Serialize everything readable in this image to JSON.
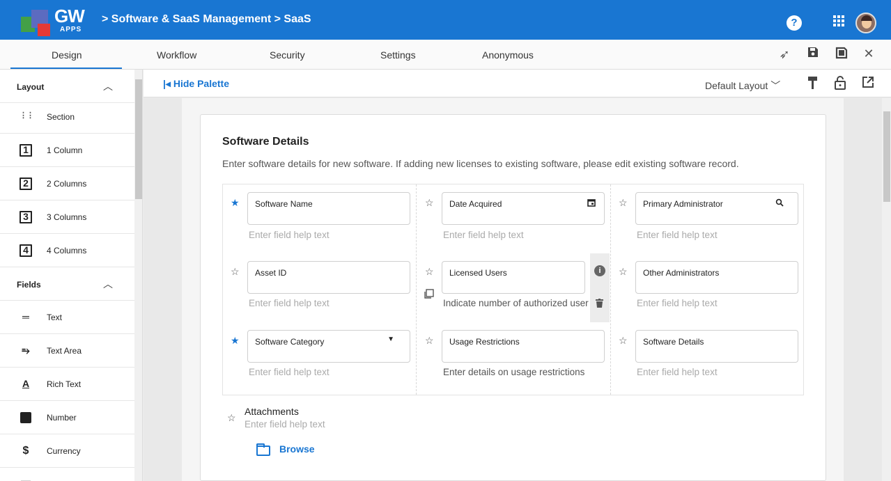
{
  "header": {
    "logo_text": "GW",
    "logo_sub": "APPS",
    "breadcrumb": "> Software & SaaS Management > SaaS",
    "help_label": "?"
  },
  "tabs": [
    {
      "label": "Design"
    },
    {
      "label": "Workflow"
    },
    {
      "label": "Security"
    },
    {
      "label": "Settings"
    },
    {
      "label": "Anonymous"
    }
  ],
  "sidebar": {
    "layout_title": "Layout",
    "fields_title": "Fields",
    "layout_items": [
      {
        "label": "Section",
        "icon": "section-icon",
        "glyph": "⋮⋮"
      },
      {
        "label": "1 Column",
        "icon": "one-column-icon",
        "glyph": "1"
      },
      {
        "label": "2 Columns",
        "icon": "two-columns-icon",
        "glyph": "2"
      },
      {
        "label": "3 Columns",
        "icon": "three-columns-icon",
        "glyph": "3"
      },
      {
        "label": "4 Columns",
        "icon": "four-columns-icon",
        "glyph": "4"
      }
    ],
    "field_items": [
      {
        "label": "Text",
        "icon": "text-icon",
        "glyph": "═"
      },
      {
        "label": "Text Area",
        "icon": "text-area-icon",
        "glyph": "⥱"
      },
      {
        "label": "Rich Text",
        "icon": "rich-text-icon",
        "glyph": "A"
      },
      {
        "label": "Number",
        "icon": "number-icon",
        "glyph": "1"
      },
      {
        "label": "Currency",
        "icon": "currency-icon",
        "glyph": "$"
      }
    ]
  },
  "palette": {
    "hide_label": "Hide Palette",
    "layout_select": "Default Layout"
  },
  "form": {
    "title": "Software Details",
    "description": "Enter software details for new software. If adding new licenses to existing software, please edit existing software record.",
    "fields": [
      {
        "label": "Software Name",
        "help": "Enter field help text",
        "required": true
      },
      {
        "label": "Date Acquired",
        "help": "Enter field help text",
        "required": false
      },
      {
        "label": "Primary Administrator",
        "help": "Enter field help text",
        "required": false
      },
      {
        "label": "Asset ID",
        "help": "Enter field help text",
        "required": false
      },
      {
        "label": "Licensed Users",
        "help": "Indicate number of authorized user",
        "required": false
      },
      {
        "label": "Other Administrators",
        "help": "Enter field help text",
        "required": false
      },
      {
        "label": "Software Category",
        "help": "Enter field help text",
        "required": true
      },
      {
        "label": "Usage Restrictions",
        "help": "Enter details on usage restrictions",
        "required": false
      },
      {
        "label": "Software Details",
        "help": "Enter field help text",
        "required": false
      }
    ],
    "attachments": {
      "label": "Attachments",
      "help": "Enter field help text",
      "browse_label": "Browse"
    }
  },
  "colors": {
    "brand": "#1976d2",
    "logo_green": "#43a047",
    "logo_red": "#e53935",
    "logo_indigo": "#5c6bc0"
  }
}
